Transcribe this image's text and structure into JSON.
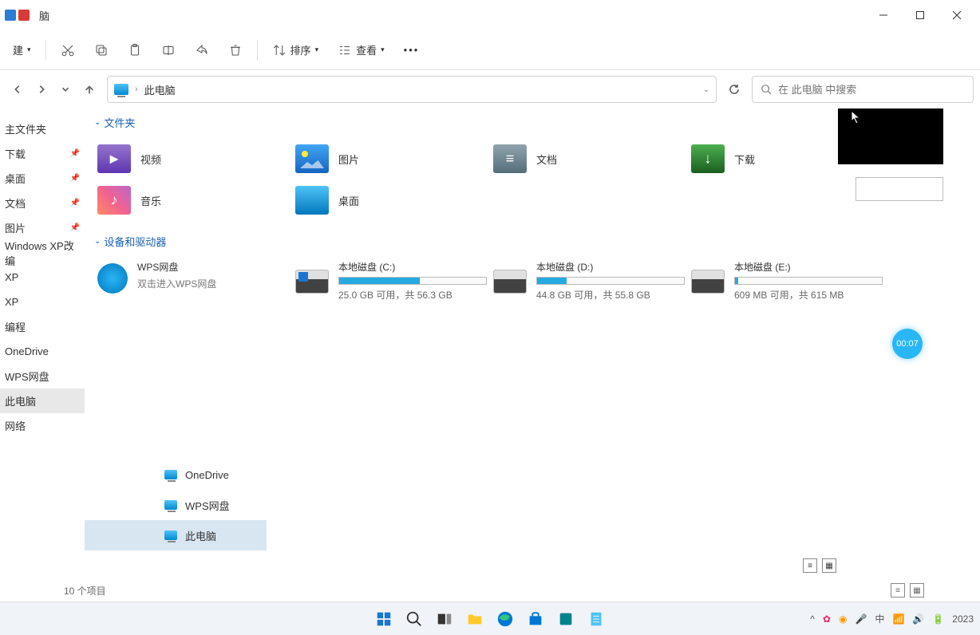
{
  "window": {
    "title": "脑"
  },
  "toolbar": {
    "new": "建",
    "sort": "排序",
    "view": "查看"
  },
  "nav": {
    "location": "此电脑",
    "breadcrumb_sep": "›"
  },
  "search": {
    "placeholder": "在 此电脑 中搜索"
  },
  "sidebar": {
    "items": [
      {
        "label": "主文件夹",
        "pin": false
      },
      {
        "label": "下载",
        "pin": true
      },
      {
        "label": "桌面",
        "pin": true
      },
      {
        "label": "文档",
        "pin": true
      },
      {
        "label": "图片",
        "pin": true
      },
      {
        "label": "Windows XP改编",
        "pin": false
      },
      {
        "label": "XP",
        "pin": false
      },
      {
        "label": "XP",
        "pin": false
      },
      {
        "label": "编程",
        "pin": false
      },
      {
        "label": "OneDrive",
        "pin": false
      },
      {
        "label": "WPS网盘",
        "pin": false
      },
      {
        "label": "此电脑",
        "pin": false,
        "active": true
      },
      {
        "label": "网络",
        "pin": false
      }
    ]
  },
  "sections": {
    "folders": "文件夹",
    "drives": "设备和驱动器"
  },
  "folders": [
    {
      "label": "视频",
      "cls": "fi-video"
    },
    {
      "label": "图片",
      "cls": "fi-pic"
    },
    {
      "label": "文档",
      "cls": "fi-doc"
    },
    {
      "label": "下载",
      "cls": "fi-down"
    },
    {
      "label": "音乐",
      "cls": "fi-music"
    },
    {
      "label": "桌面",
      "cls": "fi-desk"
    }
  ],
  "drives": [
    {
      "name": "WPS网盘",
      "sub": "双击进入WPS网盘",
      "type": "wps"
    },
    {
      "name": "本地磁盘 (C:)",
      "free": "25.0 GB 可用，共 56.3 GB",
      "fill": 55,
      "type": "win"
    },
    {
      "name": "本地磁盘 (D:)",
      "free": "44.8 GB 可用，共 55.8 GB",
      "fill": 20,
      "type": "disk"
    },
    {
      "name": "本地磁盘 (E:)",
      "free": "609 MB 可用，共 615 MB",
      "fill": 2,
      "type": "disk"
    }
  ],
  "second_pane": [
    {
      "label": "OneDrive"
    },
    {
      "label": "WPS网盘"
    },
    {
      "label": "此电脑",
      "active": true
    }
  ],
  "status": {
    "count": "10 个项目"
  },
  "timer": "00:07",
  "tray": {
    "ime": "中",
    "year": "2023"
  }
}
